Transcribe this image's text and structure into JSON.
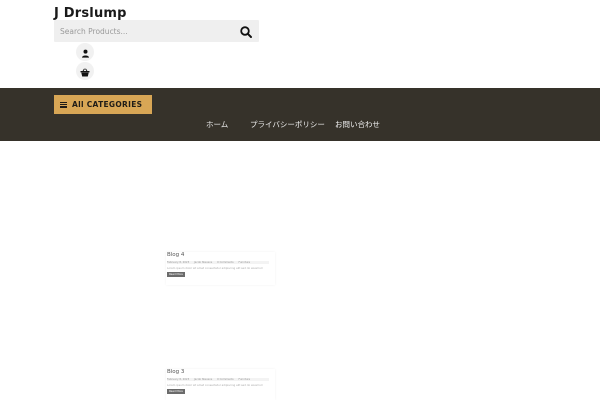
{
  "site": {
    "title": "J Drslump"
  },
  "search": {
    "placeholder": "Search Products..."
  },
  "header_icons": [
    "user-icon",
    "basket-icon"
  ],
  "nav": {
    "categories_label": "All CATEGORIES",
    "menu": [
      {
        "label": "ホーム"
      },
      {
        "label": "プライバシーポリシー"
      },
      {
        "label": "お問い合わせ"
      }
    ]
  },
  "posts": [
    {
      "title": "Blog 4",
      "meta": [
        "February 8, 2023",
        "Jacob Stevens",
        "0 Comments",
        "Furniture"
      ],
      "excerpt": "Lorem ipsum dolor sit amet consectetur adipiscing elit sed do eiusmod",
      "more_label": "Read More"
    },
    {
      "title": "Blog 3",
      "meta": [
        "February 8, 2023",
        "Jacob Stevens",
        "0 Comments",
        "Furniture"
      ],
      "excerpt": "Lorem ipsum dolor sit amet consectetur adipiscing elit sed do eiusmod",
      "more_label": "Read More"
    }
  ],
  "colors": {
    "nav_bg": "#36322a",
    "accent": "#d8a655",
    "search_bg": "#efefef"
  }
}
